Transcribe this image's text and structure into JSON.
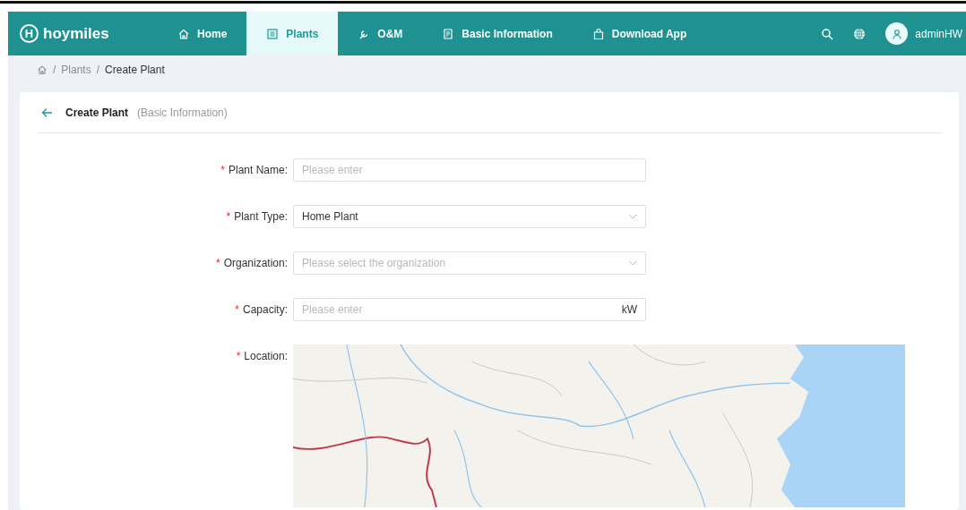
{
  "header": {
    "logo": {
      "mark": "H",
      "text": "hoymiles"
    },
    "nav": [
      {
        "label": "Home",
        "selected": false
      },
      {
        "label": "Plants",
        "selected": true
      },
      {
        "label": "O&M",
        "selected": false
      },
      {
        "label": "Basic Information",
        "selected": false
      },
      {
        "label": "Download App",
        "selected": false
      }
    ],
    "user": {
      "name": "adminHW"
    }
  },
  "breadcrumb": [
    {
      "separator": "/",
      "label": "Plants"
    },
    {
      "separator": "/",
      "label": "Create Plant"
    }
  ],
  "card": {
    "title": "Create Plant",
    "subtitle": "(Basic Information)",
    "fields": [
      {
        "kind": "input",
        "mark": "*",
        "label": "Plant Name:",
        "placeholder": "Please enter"
      },
      {
        "kind": "select",
        "mark": "*",
        "label": "Plant Type:",
        "value": "Home Plant"
      },
      {
        "kind": "select",
        "mark": "*",
        "label": "Organization:",
        "placeholder": "Please select the organization"
      },
      {
        "kind": "input",
        "mark": "*",
        "label": "Capacity:",
        "placeholder": "Please enter",
        "suffix": "kW"
      },
      {
        "kind": "map",
        "mark": "*",
        "label": "Location:"
      }
    ]
  }
}
